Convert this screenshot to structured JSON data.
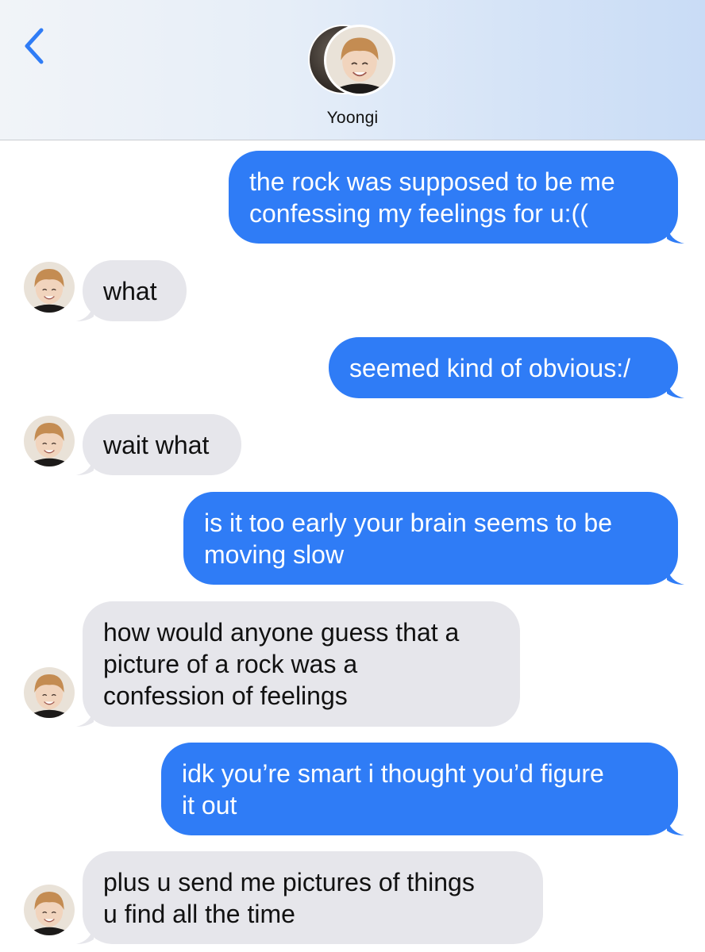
{
  "header": {
    "contact_name": "Yoongi",
    "back_icon": "chevron-left-icon",
    "accent_color": "#2f7cf6"
  },
  "messages": [
    {
      "direction": "outgoing",
      "lines": [
        "the rock was supposed to be me",
        "confessing my feelings for u:(("
      ]
    },
    {
      "direction": "incoming",
      "lines": [
        "what"
      ]
    },
    {
      "direction": "outgoing",
      "lines": [
        "seemed kind of obvious:/"
      ]
    },
    {
      "direction": "incoming",
      "lines": [
        "wait what"
      ]
    },
    {
      "direction": "outgoing",
      "lines": [
        "is it too early your brain seems to be",
        "moving slow"
      ]
    },
    {
      "direction": "incoming",
      "lines": [
        "how would anyone guess that a",
        "picture of a rock was a",
        "confession of feelings"
      ]
    },
    {
      "direction": "outgoing",
      "lines": [
        "idk you’re smart i thought you’d figure",
        "it out"
      ]
    },
    {
      "direction": "incoming",
      "lines": [
        "plus u send me pictures of things",
        "u find all the time"
      ]
    }
  ],
  "colors": {
    "outgoing_bubble": "#2f7cf6",
    "incoming_bubble": "#e6e6eb"
  }
}
